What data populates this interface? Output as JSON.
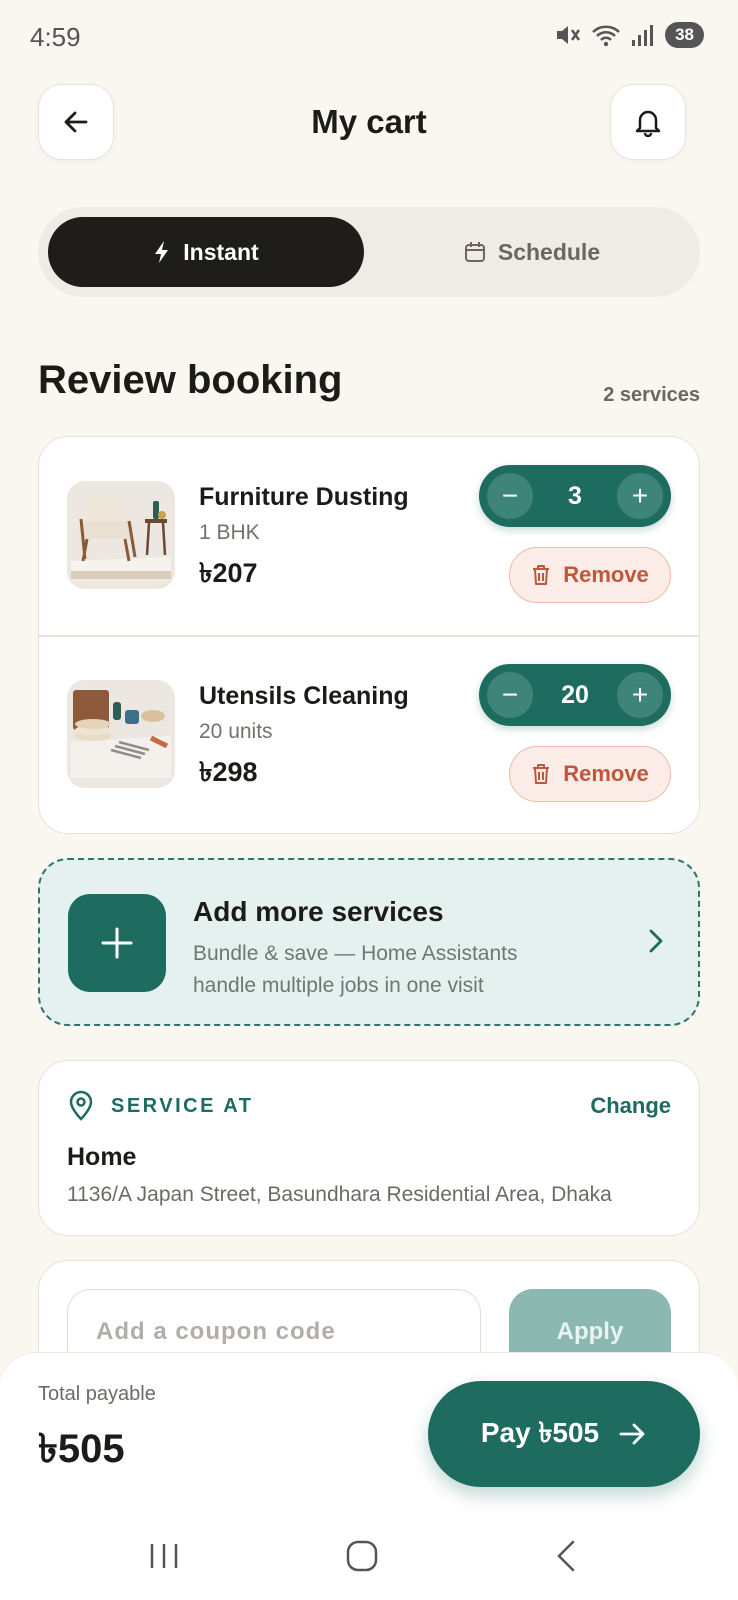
{
  "status_bar": {
    "time": "4:59",
    "battery": "38"
  },
  "header": {
    "title": "My cart"
  },
  "modes": {
    "instant": "Instant",
    "schedule": "Schedule"
  },
  "review": {
    "title": "Review booking",
    "count": "2 services"
  },
  "cart": {
    "items": [
      {
        "name": "Furniture Dusting",
        "sub": "1 BHK",
        "price": "৳207",
        "quantity": "3",
        "remove_label": "Remove"
      },
      {
        "name": "Utensils Cleaning",
        "sub": "20 units",
        "price": "৳298",
        "quantity": "20",
        "remove_label": "Remove"
      }
    ],
    "stepper": {
      "minus": "−",
      "plus": "+"
    }
  },
  "add_more": {
    "title": "Add more services",
    "description": "Bundle & save — Home Assistants handle multiple jobs in one visit"
  },
  "service_at": {
    "label": "SERVICE AT",
    "change_label": "Change",
    "place": "Home",
    "address": "1136/A Japan Street, Basundhara Residential Area, Dhaka"
  },
  "coupon": {
    "placeholder": "Add a coupon code",
    "apply_label": "Apply"
  },
  "footer": {
    "total_label": "Total payable",
    "total_value": "৳505",
    "pay_label": "Pay ৳505"
  },
  "colors": {
    "accent": "#1e6b5f",
    "background": "#faf7f1",
    "danger": "#c0573b",
    "dark": "#1e1d1a"
  }
}
